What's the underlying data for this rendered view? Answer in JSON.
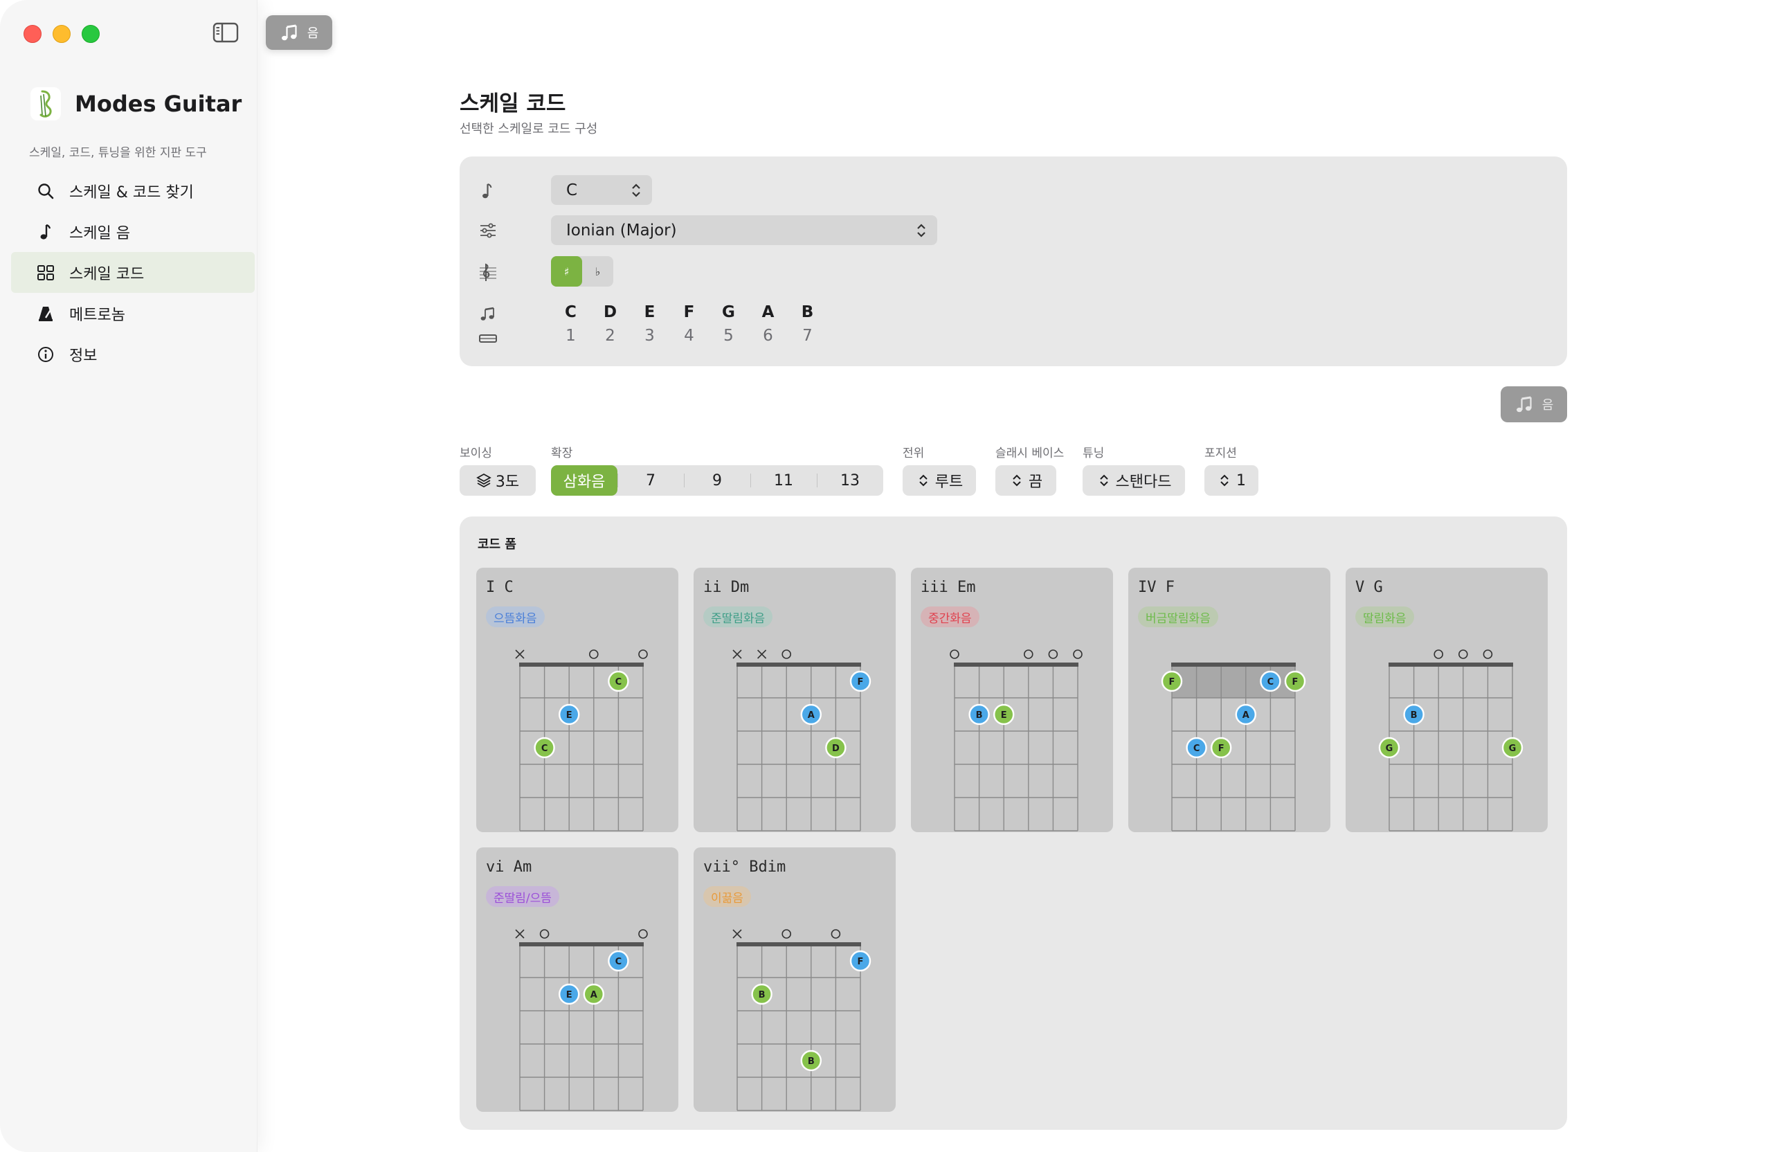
{
  "app": {
    "name": "Modes Guitar",
    "tagline": "스케일, 코드, 튜닝을 위한 지판 도구"
  },
  "topbar": {
    "chip_label": "음"
  },
  "nav": {
    "items": [
      {
        "label": "스케일 & 코드 찾기",
        "icon": "search-icon"
      },
      {
        "label": "스케일 음",
        "icon": "music-note-icon"
      },
      {
        "label": "스케일 코드",
        "icon": "grid-icon",
        "active": true
      },
      {
        "label": "메트로놈",
        "icon": "metronome-icon"
      },
      {
        "label": "정보",
        "icon": "info-icon"
      }
    ]
  },
  "page": {
    "title": "스케일 코드",
    "subtitle": "선택한 스케일로 코드 구성"
  },
  "config": {
    "root": "C",
    "mode": "Ionian (Major)",
    "accidentals": [
      "♯",
      "♭"
    ],
    "accidental_selected": "♯",
    "scale_notes": [
      "C",
      "D",
      "E",
      "F",
      "G",
      "A",
      "B"
    ],
    "scale_degrees": [
      "1",
      "2",
      "3",
      "4",
      "5",
      "6",
      "7"
    ]
  },
  "notes_button": {
    "label": "음"
  },
  "controls": {
    "voicing": {
      "label": "보이싱",
      "value": "3도"
    },
    "extension": {
      "label": "확장",
      "options": [
        "삼화음",
        "7",
        "9",
        "11",
        "13"
      ],
      "selected": "삼화음"
    },
    "inversion": {
      "label": "전위",
      "value": "루트"
    },
    "slash_bass": {
      "label": "슬래시 베이스",
      "value": "끔"
    },
    "tuning": {
      "label": "튜닝",
      "value": "스탠다드"
    },
    "position": {
      "label": "포지션",
      "value": "1"
    }
  },
  "colors": {
    "accent_green": "#7cb342",
    "dot_blue": "#4aa8e8",
    "dot_green": "#86c24b"
  },
  "forms": {
    "title": "코드 폼",
    "chords": [
      {
        "name": "I C",
        "badge": "으뜸화음",
        "badge_fg": "#4a7fd8",
        "badge_bg": "#b7c4d8",
        "open": [
          "x",
          "",
          "",
          "o",
          "",
          "o"
        ],
        "barre": null,
        "dots": [
          {
            "s": 4,
            "f": 1,
            "n": "C",
            "c": "g"
          },
          {
            "s": 2,
            "f": 2,
            "n": "E",
            "c": "b"
          },
          {
            "s": 1,
            "f": 3,
            "n": "C",
            "c": "g"
          }
        ]
      },
      {
        "name": "ii Dm",
        "badge": "준딸림화음",
        "badge_fg": "#3f9e88",
        "badge_bg": "#b5cbc4",
        "open": [
          "x",
          "x",
          "o",
          "",
          "",
          ""
        ],
        "barre": null,
        "dots": [
          {
            "s": 5,
            "f": 1,
            "n": "F",
            "c": "b"
          },
          {
            "s": 3,
            "f": 2,
            "n": "A",
            "c": "b"
          },
          {
            "s": 4,
            "f": 3,
            "n": "D",
            "c": "g"
          }
        ]
      },
      {
        "name": "iii Em",
        "badge": "중간화음",
        "badge_fg": "#e0424f",
        "badge_bg": "#d6b3b6",
        "open": [
          "o",
          "",
          "",
          "o",
          "o",
          "o"
        ],
        "barre": null,
        "dots": [
          {
            "s": 1,
            "f": 2,
            "n": "B",
            "c": "b"
          },
          {
            "s": 2,
            "f": 2,
            "n": "E",
            "c": "g"
          }
        ]
      },
      {
        "name": "IV F",
        "badge": "버금딸림화음",
        "badge_fg": "#6dbb4a",
        "badge_bg": "#bccab1",
        "open": [
          "",
          "",
          "",
          "",
          "",
          ""
        ],
        "barre": {
          "fret": 1,
          "from": 0,
          "to": 5
        },
        "dots": [
          {
            "s": 0,
            "f": 1,
            "n": "F",
            "c": "g"
          },
          {
            "s": 4,
            "f": 1,
            "n": "C",
            "c": "b"
          },
          {
            "s": 5,
            "f": 1,
            "n": "F",
            "c": "g"
          },
          {
            "s": 3,
            "f": 2,
            "n": "A",
            "c": "b"
          },
          {
            "s": 1,
            "f": 3,
            "n": "C",
            "c": "b"
          },
          {
            "s": 2,
            "f": 3,
            "n": "F",
            "c": "g"
          }
        ]
      },
      {
        "name": "V G",
        "badge": "딸림화음",
        "badge_fg": "#6dbb4a",
        "badge_bg": "#bccab1",
        "open": [
          "",
          "",
          "o",
          "o",
          "o",
          ""
        ],
        "barre": null,
        "dots": [
          {
            "s": 1,
            "f": 2,
            "n": "B",
            "c": "b"
          },
          {
            "s": 0,
            "f": 3,
            "n": "G",
            "c": "g"
          },
          {
            "s": 5,
            "f": 3,
            "n": "G",
            "c": "g"
          }
        ]
      },
      {
        "name": "vi Am",
        "badge": "준딸림/으뜸",
        "badge_fg": "#9b4fd8",
        "badge_bg": "#c7b6d8",
        "open": [
          "x",
          "o",
          "",
          "",
          "",
          "o"
        ],
        "barre": null,
        "dots": [
          {
            "s": 4,
            "f": 1,
            "n": "C",
            "c": "b"
          },
          {
            "s": 2,
            "f": 2,
            "n": "E",
            "c": "b"
          },
          {
            "s": 3,
            "f": 2,
            "n": "A",
            "c": "g"
          }
        ]
      },
      {
        "name": "vii° Bdim",
        "badge": "이끎음",
        "badge_fg": "#e89a3a",
        "badge_bg": "#d8c6ae",
        "open": [
          "x",
          "",
          "o",
          "",
          "o",
          ""
        ],
        "barre": null,
        "dots": [
          {
            "s": 5,
            "f": 1,
            "n": "F",
            "c": "b"
          },
          {
            "s": 1,
            "f": 2,
            "n": "B",
            "c": "g"
          },
          {
            "s": 3,
            "f": 4,
            "n": "B",
            "c": "g"
          }
        ]
      }
    ]
  }
}
